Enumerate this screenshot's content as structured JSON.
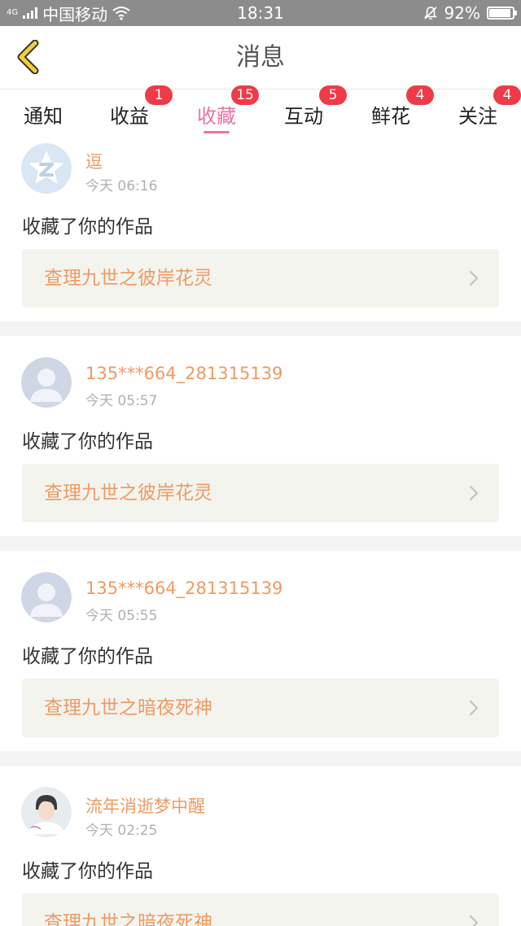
{
  "status_bar": {
    "network": "4G",
    "carrier": "中国移动",
    "time": "18:31",
    "battery": "92%",
    "battery_level": 0.92,
    "icons": [
      "signal-icon",
      "wifi-icon",
      "mute-bell-icon",
      "battery-icon"
    ]
  },
  "header": {
    "title": "消息",
    "back_icon": "chevron-left-icon"
  },
  "tabs": [
    {
      "label": "通知",
      "badge": ""
    },
    {
      "label": "收益",
      "badge": "1"
    },
    {
      "label": "收藏",
      "badge": "15",
      "active": true
    },
    {
      "label": "互动",
      "badge": "5"
    },
    {
      "label": "鲜花",
      "badge": "4"
    },
    {
      "label": "关注",
      "badge": "4"
    }
  ],
  "items": [
    {
      "avatar": "qq-logo-avatar",
      "username": "逗",
      "time": "今天 06:16",
      "action": "收藏了你的作品",
      "work": "查理九世之彼岸花灵"
    },
    {
      "avatar": "default-user-avatar",
      "username": "135***664_281315139",
      "time": "今天 05:57",
      "action": "收藏了你的作品",
      "work": "查理九世之彼岸花灵"
    },
    {
      "avatar": "default-user-avatar",
      "username": "135***664_281315139",
      "time": "今天 05:55",
      "action": "收藏了你的作品",
      "work": "查理九世之暗夜死神"
    },
    {
      "avatar": "photo-avatar",
      "username": "流年消逝梦中醒",
      "time": "今天 02:25",
      "action": "收藏了你的作品",
      "work": "查理九世之暗夜死神"
    }
  ],
  "colors": {
    "accent": "#e874a3",
    "username": "#ef9a63",
    "badge": "#ef3b47",
    "status_bar": "#8c8c8c",
    "back_icon": "#f2cf3a"
  }
}
